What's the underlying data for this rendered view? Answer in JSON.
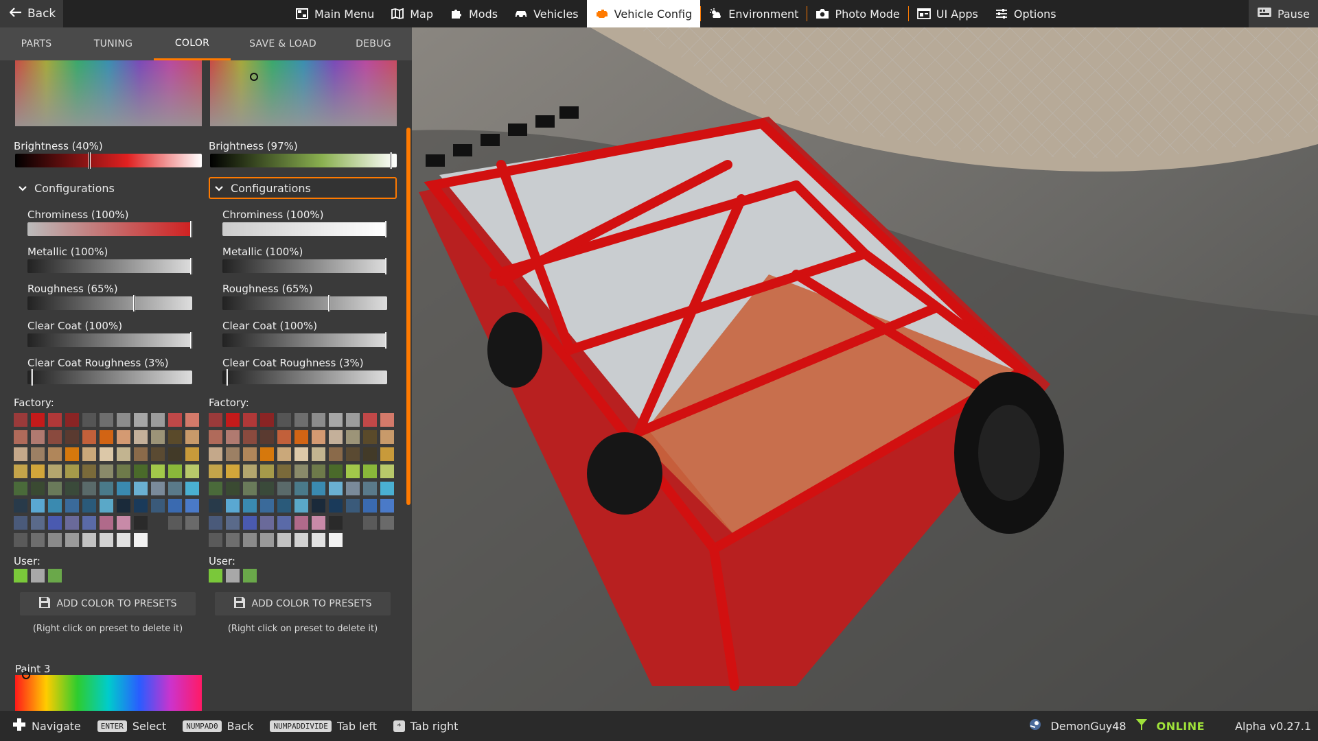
{
  "topbar": {
    "back_label": "Back",
    "nav": [
      {
        "label": "Main Menu",
        "icon": "grid-icon"
      },
      {
        "label": "Map",
        "icon": "map-icon"
      },
      {
        "label": "Mods",
        "icon": "puzzle-icon"
      },
      {
        "label": "Vehicles",
        "icon": "car-icon"
      },
      {
        "label": "Vehicle Config",
        "icon": "engine-icon",
        "active": true
      },
      {
        "label": "Environment",
        "icon": "weather-icon"
      },
      {
        "label": "Photo Mode",
        "icon": "camera-icon"
      },
      {
        "label": "UI Apps",
        "icon": "apps-icon"
      },
      {
        "label": "Options",
        "icon": "sliders-icon"
      }
    ],
    "pause_label": "Pause",
    "accent": "#ff7a00"
  },
  "tabs": [
    "PARTS",
    "TUNING",
    "COLOR",
    "SAVE & LOAD",
    "DEBUG"
  ],
  "active_tab": "COLOR",
  "color_columns": [
    {
      "brightness_label": "Brightness (40%)",
      "brightness": 0.4,
      "config_label": "Configurations",
      "config_active": false,
      "sliders": [
        {
          "label": "Chrominess (100%)",
          "value": 1.0
        },
        {
          "label": "Metallic (100%)",
          "value": 1.0
        },
        {
          "label": "Roughness (65%)",
          "value": 0.65
        },
        {
          "label": "Clear Coat (100%)",
          "value": 1.0
        },
        {
          "label": "Clear Coat Roughness (3%)",
          "value": 0.03
        }
      ],
      "factory_label": "Factory:",
      "user_label": "User:",
      "add_button_label": "ADD COLOR TO PRESETS",
      "hint": "(Right click on preset to delete it)"
    },
    {
      "brightness_label": "Brightness (97%)",
      "brightness": 0.97,
      "config_label": "Configurations",
      "config_active": true,
      "sliders": [
        {
          "label": "Chrominess (100%)",
          "value": 1.0
        },
        {
          "label": "Metallic (100%)",
          "value": 1.0
        },
        {
          "label": "Roughness (65%)",
          "value": 0.65
        },
        {
          "label": "Clear Coat (100%)",
          "value": 1.0
        },
        {
          "label": "Clear Coat Roughness (3%)",
          "value": 0.03
        }
      ],
      "factory_label": "Factory:",
      "user_label": "User:",
      "add_button_label": "ADD COLOR TO PRESETS",
      "hint": "(Right click on preset to delete it)"
    }
  ],
  "paint3_label": "Paint 3",
  "factory_swatches": [
    "#9a3a3a",
    "#c41a1a",
    "#b03838",
    "#8a2424",
    "#555555",
    "#6e6e6e",
    "#8c8c8c",
    "#a6a6a6",
    "#9c9c9c",
    "#c04848",
    "#d47a6a",
    "#b06a5a",
    "#b07a70",
    "#8a4a3e",
    "#5a3a30",
    "#c2603a",
    "#d26414",
    "#d49a72",
    "#c4b09a",
    "#9c9478",
    "#5a4a2a",
    "#c89a6a",
    "#c4a88a",
    "#9c8064",
    "#b0865a",
    "#d6780c",
    "#caa87a",
    "#dcc8a8",
    "#c2b490",
    "#8a6a4a",
    "#5a4a32",
    "#423a28",
    "#c89a3a",
    "#c4a44a",
    "#d2a63a",
    "#b4a66e",
    "#a69a4a",
    "#7a6a3a",
    "#8a8a6a",
    "#6e7a4a",
    "#4a6a2a",
    "#a2c84a",
    "#8ab83a",
    "#b8c86a",
    "#4a6a3a",
    "#3a4a32",
    "#6a7a5a",
    "#3a4a3a",
    "#5a6a6a",
    "#4a7a8a",
    "#3a8ab0",
    "#6ab0d2",
    "#7a8a9a",
    "#5a7a8a",
    "#4ab0d2",
    "#283a4a",
    "#5aa8d2",
    "#3a8ab0",
    "#3a6a9a",
    "#2a5a7a",
    "#5aa8c8",
    "#1a2a3a",
    "#1a3a5a",
    "#3a5a7a",
    "#3a6ab0",
    "#4a7ac8",
    "#4a5a7a",
    "#5a6a8a",
    "#4a5ab0",
    "#6a6a9a",
    "#5a6aa8",
    "#b06a8a",
    "#c88aa8",
    "#2a2a2a",
    "#3a3a3a",
    "#5a5a5a",
    "#6a6a6a",
    "#5a5a5a",
    "#6e6e6e",
    "#8a8a8a",
    "#9a9a9a",
    "#c2c2c2",
    "#d2d2d2",
    "#e2e2e2",
    "#f2f2f2"
  ],
  "user_swatches": [
    "#7ac83a",
    "#a8a8a8",
    "#6aa84a"
  ],
  "bottombar": {
    "hotkeys": [
      {
        "key": "",
        "label": "Navigate",
        "icon": "dpad-icon"
      },
      {
        "key": "ENTER",
        "label": "Select"
      },
      {
        "key": "NUMPAD0",
        "label": "Back"
      },
      {
        "key": "NUMPADDIVIDE",
        "label": "Tab left"
      },
      {
        "key": "*",
        "label": "Tab right"
      }
    ],
    "username": "DemonGuy48",
    "status": "ONLINE",
    "version": "Alpha v0.27.1"
  }
}
